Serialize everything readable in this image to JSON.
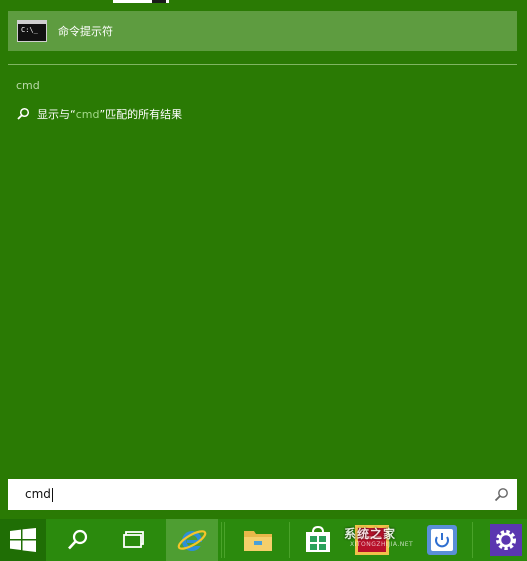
{
  "start_menu": {
    "best_match": {
      "label": "命令提示符",
      "icon": "cmd-console-icon"
    },
    "query_label": "cmd",
    "web_result": {
      "prefix": "显示与“",
      "term": "cmd",
      "suffix": "”匹配的所有结果",
      "icon": "search-icon"
    }
  },
  "search": {
    "value": "cmd",
    "icon": "search-icon"
  },
  "taskbar": {
    "items": [
      {
        "name": "start-button",
        "icon": "windows-logo-icon"
      },
      {
        "name": "search-button",
        "icon": "search-icon"
      },
      {
        "name": "task-view-button",
        "icon": "task-view-icon"
      },
      {
        "name": "internet-explorer",
        "icon": "ie-icon"
      },
      {
        "name": "file-explorer",
        "icon": "folder-icon"
      },
      {
        "name": "store",
        "icon": "store-icon"
      },
      {
        "name": "app-red",
        "icon": "red-app-icon"
      },
      {
        "name": "app-power",
        "icon": "power-icon"
      },
      {
        "name": "settings",
        "icon": "gear-icon"
      }
    ]
  },
  "watermark": {
    "text": "系统之家",
    "sub": "XITONGZHIJIA.NET"
  },
  "colors": {
    "background": "#2a7a04",
    "highlight": "#5e9c40",
    "taskbar": "#2b8a0d"
  }
}
